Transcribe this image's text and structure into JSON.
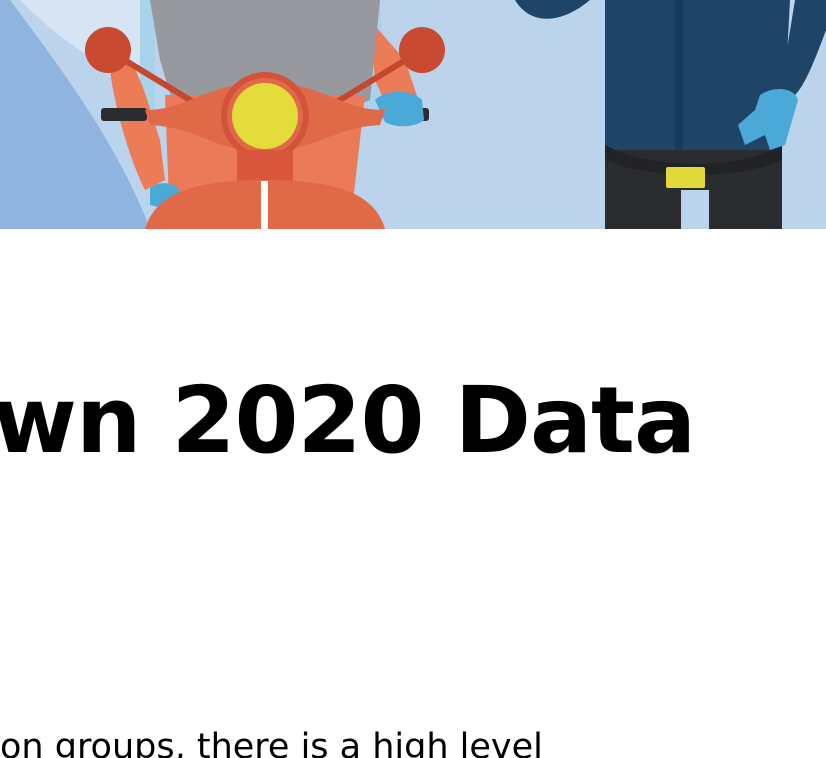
{
  "hero": {
    "illustration": "delivery-rider-on-scooter-and-person-in-blue-jacket",
    "colors": {
      "sky": "#bcd3ec",
      "left_panel": "#8fb4df",
      "scooter": "#e06a48",
      "headlight": "#e3dc3a",
      "jacket": "#1e4468",
      "glove": "#4aa9d6",
      "belt_buckle": "#e2d93a"
    }
  },
  "article": {
    "headline": "wn 2020 Data",
    "body_fragment": "on groups, there is a high level"
  }
}
